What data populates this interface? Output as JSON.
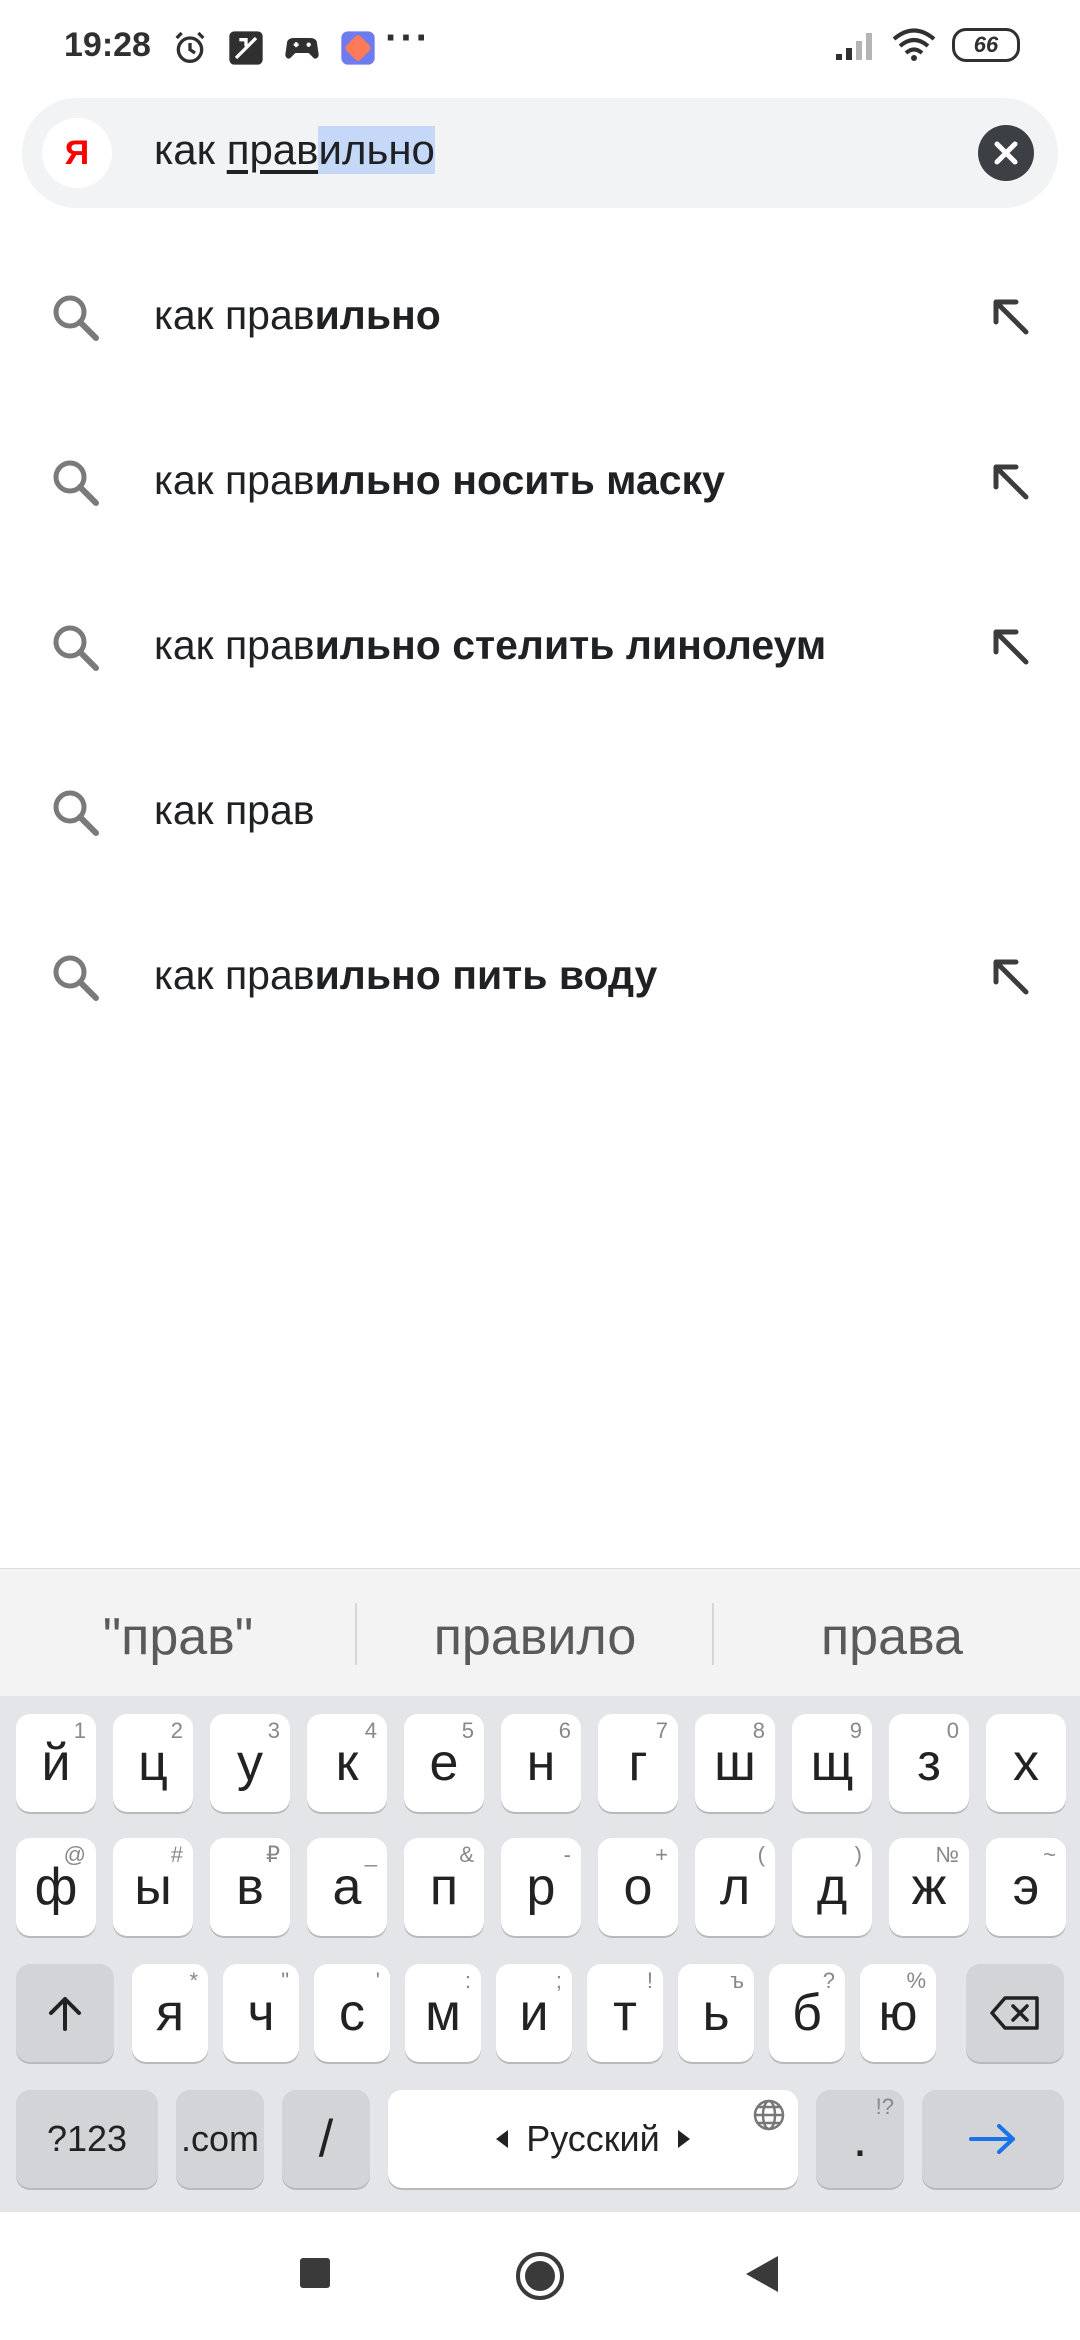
{
  "status_bar": {
    "time": "19:28",
    "more_dots": "···",
    "battery_level": "66",
    "icons": [
      "alarm-icon",
      "media-icon",
      "gamepad-icon",
      "app-icon",
      "signal-icon",
      "wifi-icon",
      "battery-icon"
    ]
  },
  "search": {
    "logo_letter": "Я",
    "query_typed": "прав",
    "query_prefix": "как ",
    "query_completion": "ильно"
  },
  "suggestions": [
    {
      "normal": "как прав",
      "bold": "ильно",
      "has_arrow": true
    },
    {
      "normal": "как прав",
      "bold": "ильно носить маску",
      "has_arrow": true
    },
    {
      "normal": "как прав",
      "bold": "ильно стелить линолеум",
      "has_arrow": true
    },
    {
      "normal": "как прав",
      "bold": "",
      "has_arrow": false
    },
    {
      "normal": "как прав",
      "bold": "ильно пить воду",
      "has_arrow": true
    }
  ],
  "keyboard": {
    "word_suggestions": [
      "\"прав\"",
      "правило",
      "права"
    ],
    "row1": [
      {
        "k": "й",
        "s": "1"
      },
      {
        "k": "ц",
        "s": "2"
      },
      {
        "k": "у",
        "s": "3"
      },
      {
        "k": "к",
        "s": "4"
      },
      {
        "k": "е",
        "s": "5"
      },
      {
        "k": "н",
        "s": "6"
      },
      {
        "k": "г",
        "s": "7"
      },
      {
        "k": "ш",
        "s": "8"
      },
      {
        "k": "щ",
        "s": "9"
      },
      {
        "k": "з",
        "s": "0"
      },
      {
        "k": "х",
        "s": ""
      }
    ],
    "row2": [
      {
        "k": "ф",
        "s": "@"
      },
      {
        "k": "ы",
        "s": "#"
      },
      {
        "k": "в",
        "s": "₽"
      },
      {
        "k": "а",
        "s": "_"
      },
      {
        "k": "п",
        "s": "&"
      },
      {
        "k": "р",
        "s": "-"
      },
      {
        "k": "о",
        "s": "+"
      },
      {
        "k": "л",
        "s": "("
      },
      {
        "k": "д",
        "s": ")"
      },
      {
        "k": "ж",
        "s": "№"
      },
      {
        "k": "э",
        "s": "~"
      }
    ],
    "row3": [
      {
        "k": "я",
        "s": "*"
      },
      {
        "k": "ч",
        "s": "\""
      },
      {
        "k": "с",
        "s": "'"
      },
      {
        "k": "м",
        "s": ":"
      },
      {
        "k": "и",
        "s": ";"
      },
      {
        "k": "т",
        "s": "!"
      },
      {
        "k": "ь",
        "s": "ъ"
      },
      {
        "k": "б",
        "s": "?"
      },
      {
        "k": "ю",
        "s": "%"
      }
    ],
    "symbols_label": "?123",
    "com_label": ".com",
    "slash_label": "/",
    "space_label": "Русский",
    "period_label": ".",
    "period_sup": "!?"
  },
  "colors": {
    "accent": "#1a73e8",
    "search_bg": "#f1f3f5",
    "highlight": "#c5d8f7",
    "keyboard_bg": "#e4e5e8"
  }
}
